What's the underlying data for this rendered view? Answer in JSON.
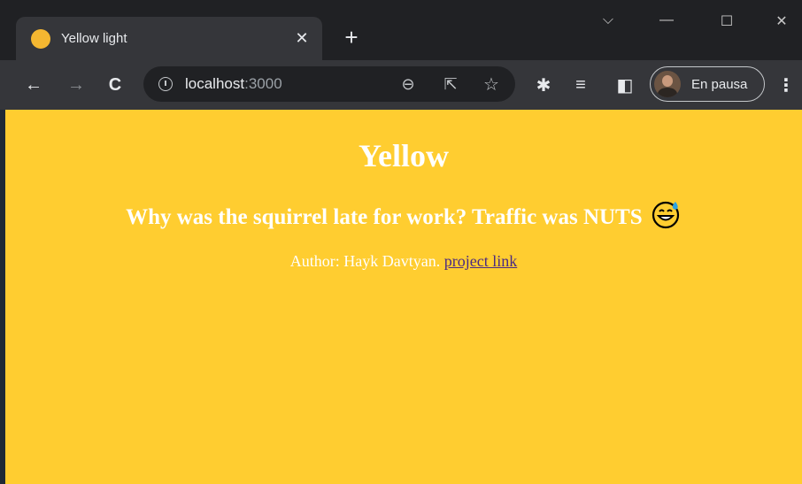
{
  "browser": {
    "tab": {
      "title": "Yellow light",
      "close_glyph": "✕",
      "favicon_color": "#f4b731"
    },
    "new_tab_glyph": "+",
    "window_controls": {
      "tab_search": "⌵",
      "minimize": "—",
      "maximize": "☐",
      "close": "✕"
    },
    "toolbar": {
      "back": "←",
      "forward": "→",
      "reload": "C",
      "url_host": "localhost",
      "url_port": ":3000",
      "zoom_icon": "⊖",
      "share_icon": "⇱",
      "star_icon": "☆",
      "extensions_icon": "✱",
      "reading_list_icon": "≡",
      "side_panel_icon": "◧",
      "profile_label": "En pausa",
      "menu_icon": "⋮"
    }
  },
  "page": {
    "background": "#ffcd30",
    "heading": "Yellow",
    "joke": "Why was the squirrel late for work? Traffic was NUTS",
    "author_prefix": "Author: Hayk Davtyan.",
    "project_link": "project link",
    "link_color": "#4b2a82"
  }
}
